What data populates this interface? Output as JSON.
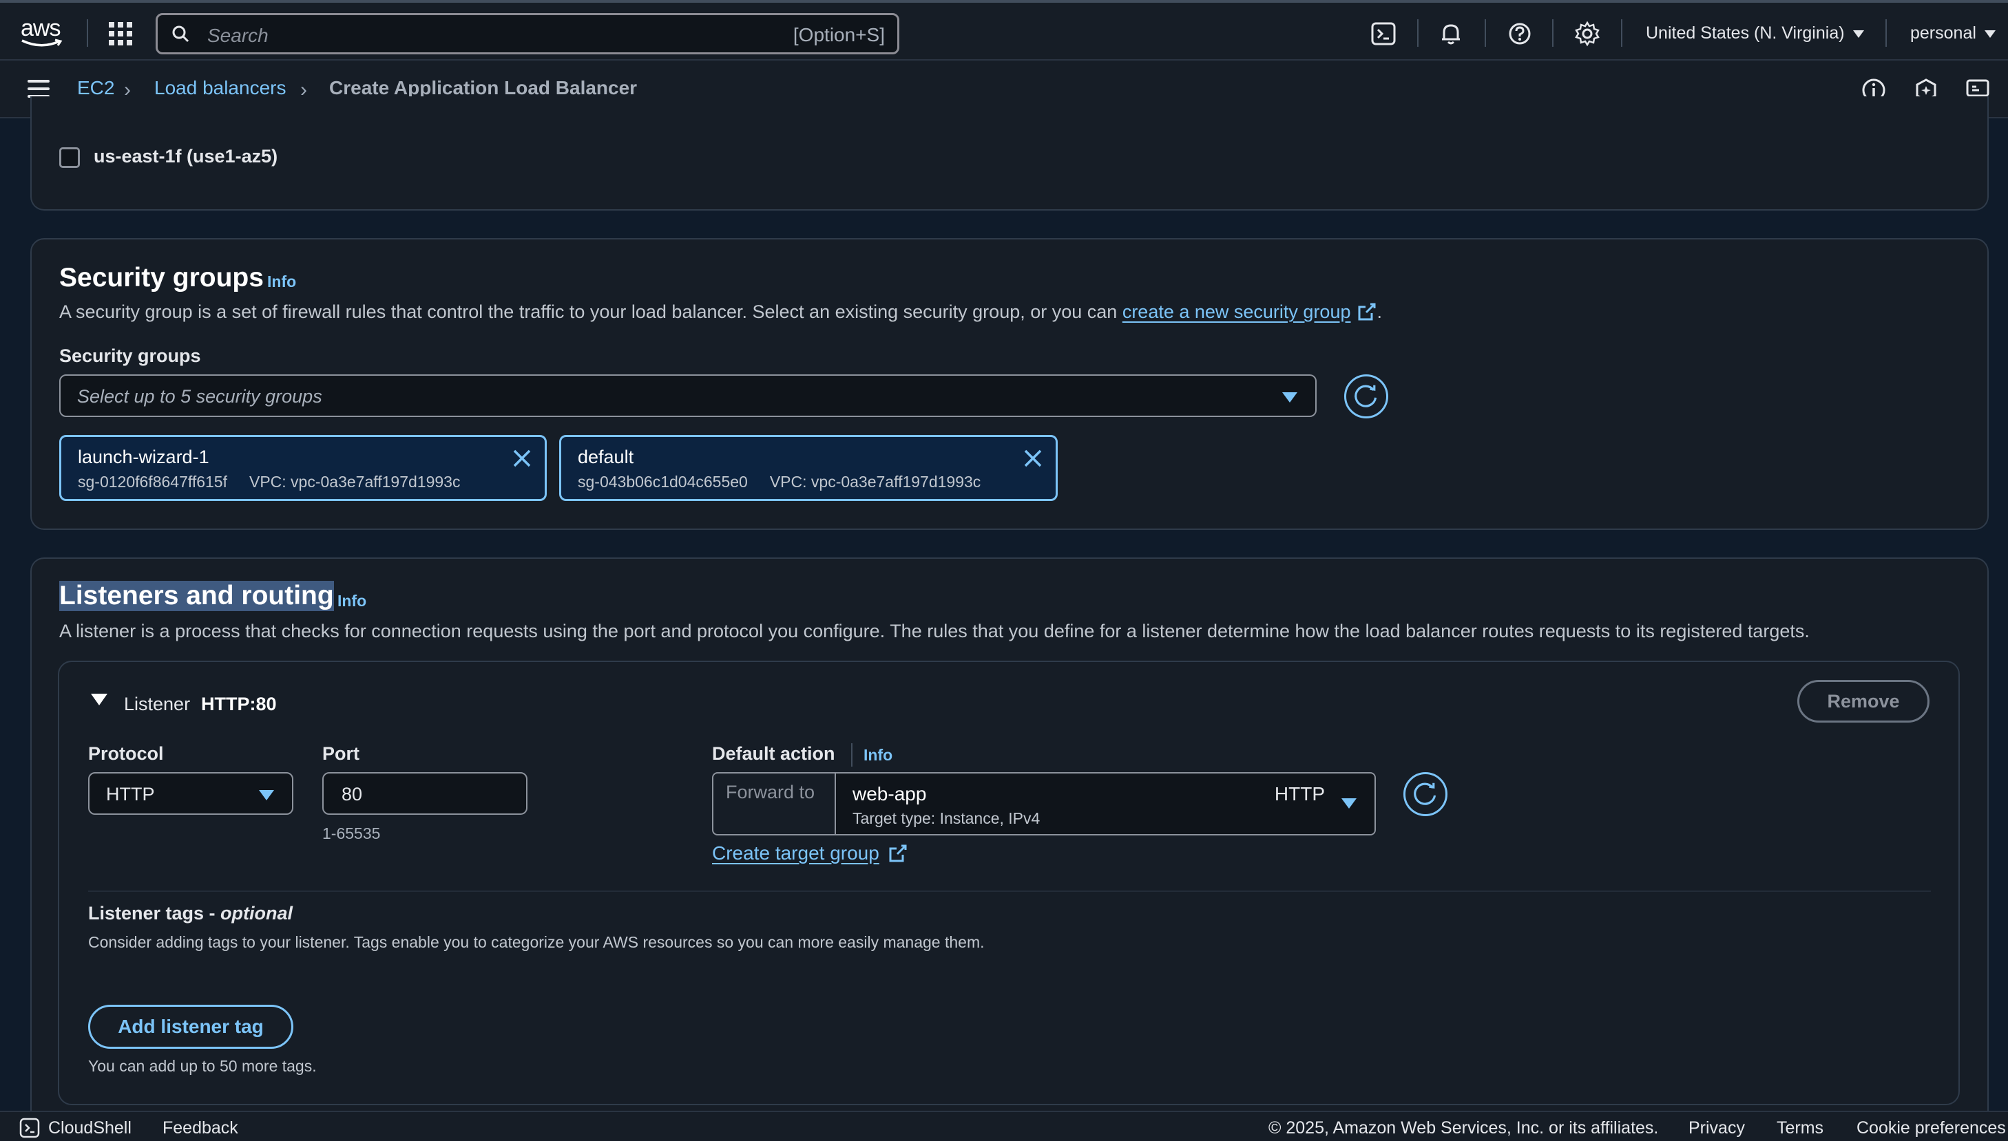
{
  "topbar": {
    "logo_text": "aws",
    "search_placeholder": "Search",
    "search_shortcut": "[Option+S]",
    "region": "United States (N. Virginia)",
    "account": "personal"
  },
  "breadcrumb": {
    "items": [
      "EC2",
      "Load balancers",
      "Create Application Load Balancer"
    ]
  },
  "availability_zone": {
    "label": "us-east-1f (use1-az5)",
    "checked": false
  },
  "security_groups": {
    "title": "Security groups",
    "info": "Info",
    "description_prefix": "A security group is a set of firewall rules that control the traffic to your load balancer. Select an existing security group, or you can ",
    "description_link": "create a new security group",
    "description_suffix": ".",
    "field_label": "Security groups",
    "placeholder": "Select up to 5 security groups",
    "selected": [
      {
        "name": "launch-wizard-1",
        "id": "sg-0120f6f8647ff615f",
        "vpc": "VPC: vpc-0a3e7aff197d1993c"
      },
      {
        "name": "default",
        "id": "sg-043b06c1d04c655e0",
        "vpc": "VPC: vpc-0a3e7aff197d1993c"
      }
    ]
  },
  "listeners": {
    "title": "Listeners and routing",
    "info": "Info",
    "description": "A listener is a process that checks for connection requests using the port and protocol you configure. The rules that you define for a listener determine how the load balancer routes requests to its registered targets.",
    "listener": {
      "label": "Listener",
      "name": "HTTP:80",
      "remove": "Remove",
      "protocol_label": "Protocol",
      "protocol_value": "HTTP",
      "port_label": "Port",
      "port_value": "80",
      "port_hint": "1-65535",
      "default_action_label": "Default action",
      "default_action_info": "Info",
      "forward_to": "Forward to",
      "target_group_name": "web-app",
      "target_group_type": "Target type: Instance, IPv4",
      "target_group_protocol": "HTTP",
      "create_target_group": "Create target group",
      "tags_label": "Listener tags - ",
      "tags_optional": "optional",
      "tags_description": "Consider adding tags to your listener. Tags enable you to categorize your AWS resources so you can more easily manage them.",
      "add_tag": "Add listener tag",
      "tags_hint": "You can add up to 50 more tags."
    }
  },
  "footer": {
    "cloudshell": "CloudShell",
    "feedback": "Feedback",
    "copyright": "© 2025, Amazon Web Services, Inc. or its affiliates.",
    "privacy": "Privacy",
    "terms": "Terms",
    "cookies": "Cookie preferences"
  },
  "colors": {
    "accent": "#7cc4f8",
    "background": "#0f1b2a",
    "panel": "#161d26"
  }
}
